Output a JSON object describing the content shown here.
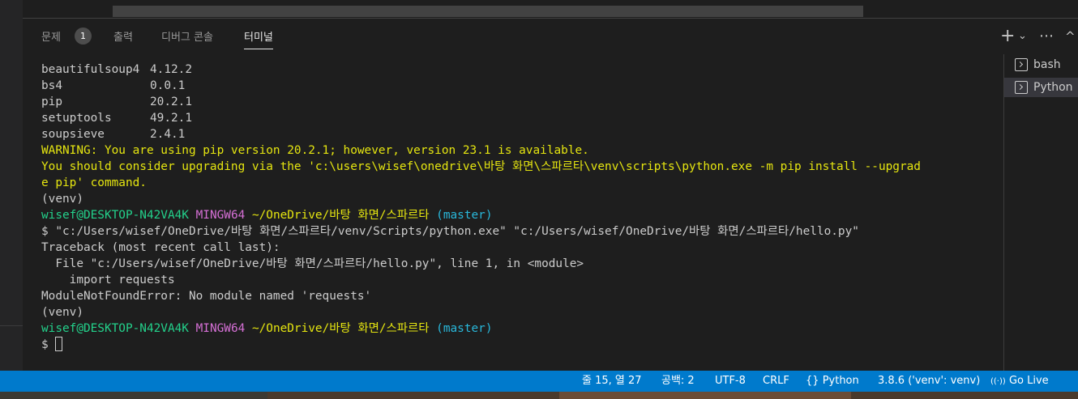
{
  "panel": {
    "tabs": [
      {
        "label": "문제"
      },
      {
        "label": "출력"
      },
      {
        "label": "디버그 콘솔"
      },
      {
        "label": "터미널"
      }
    ],
    "problems_count": "1",
    "actions": {
      "add": "+",
      "dropdown": "⌄",
      "more": "⋯",
      "collapse": "^"
    }
  },
  "terminal": {
    "packages": [
      {
        "name": "beautifulsoup4",
        "version": "4.12.2"
      },
      {
        "name": "bs4",
        "version": "0.0.1"
      },
      {
        "name": "pip",
        "version": "20.2.1"
      },
      {
        "name": "setuptools",
        "version": "49.2.1"
      },
      {
        "name": "soupsieve",
        "version": "2.4.1"
      }
    ],
    "warning_1": "WARNING: You are using pip version 20.2.1; however, version 23.1 is available.",
    "warning_2": "You should consider upgrading via the 'c:\\users\\wisef\\onedrive\\바탕 화면\\스파르타\\venv\\scripts\\python.exe -m pip install --upgrad",
    "warning_3": "e pip' command.",
    "venv": "(venv)",
    "prompt_user": "wisef@DESKTOP-N42VA4K",
    "prompt_shell": "MINGW64",
    "prompt_path": "~/OneDrive/바탕 화면/스파르타",
    "prompt_branch": "(master)",
    "command": "$ \"c:/Users/wisef/OneDrive/바탕 화면/스파르타/venv/Scripts/python.exe\" \"c:/Users/wisef/OneDrive/바탕 화면/스파르타/hello.py\"",
    "traceback_1": "Traceback (most recent call last):",
    "traceback_2": "  File \"c:/Users/wisef/OneDrive/바탕 화면/스파르타/hello.py\", line 1, in <module>",
    "traceback_3": "    import requests",
    "error": "ModuleNotFoundError: No module named 'requests'",
    "dollar": "$ "
  },
  "terminal_list": [
    {
      "label": "bash"
    },
    {
      "label": "Python"
    }
  ],
  "statusbar": {
    "position": "줄 15, 열 27",
    "spaces": "공백: 2",
    "encoding": "UTF-8",
    "eol": "CRLF",
    "language_icon": "{}",
    "language": "Python",
    "interpreter": "3.8.6 ('venv': venv)",
    "golive_icon": "((·))",
    "golive": "Go Live"
  }
}
